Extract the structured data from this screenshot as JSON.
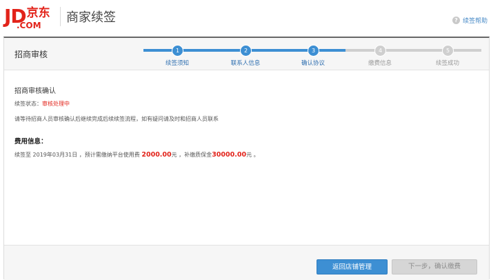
{
  "header": {
    "logo_jd": "JD",
    "logo_cn": "京东",
    "logo_com": ".COM",
    "app_title": "商家续签",
    "help_label": "续签帮助",
    "help_icon": "question-icon"
  },
  "panel": {
    "title": "招商审核"
  },
  "steps": [
    {
      "num": "1",
      "label": "续签须知",
      "state": "done"
    },
    {
      "num": "2",
      "label": "联系人信息",
      "state": "done"
    },
    {
      "num": "3",
      "label": "确认协议",
      "state": "current"
    },
    {
      "num": "4",
      "label": "缴费信息",
      "state": "todo"
    },
    {
      "num": "5",
      "label": "续签成功",
      "state": "todo"
    }
  ],
  "content": {
    "section_title": "招商审核确认",
    "status_label": "续签状态：",
    "status_value": "审核处理中",
    "notice": "请等待招商人员审核确认后继续完成后续续签流程，如有疑问请及时和招商人员联系",
    "fee_title": "费用信息：",
    "fee_prefix": "续签至 2019年03月31日 ，预计需缴纳平台使用费",
    "platform_fee": "2000.00",
    "fee_unit1": "元 ，补缴质保金",
    "deposit": "30000.00",
    "fee_unit2": "元 。"
  },
  "footer": {
    "back_label": "返回店铺管理",
    "next_label": "下一步，确认缴费"
  },
  "colors": {
    "brand_red": "#e2231a",
    "accent_blue": "#3d8fd3",
    "inactive_grey": "#cfcfcf"
  }
}
